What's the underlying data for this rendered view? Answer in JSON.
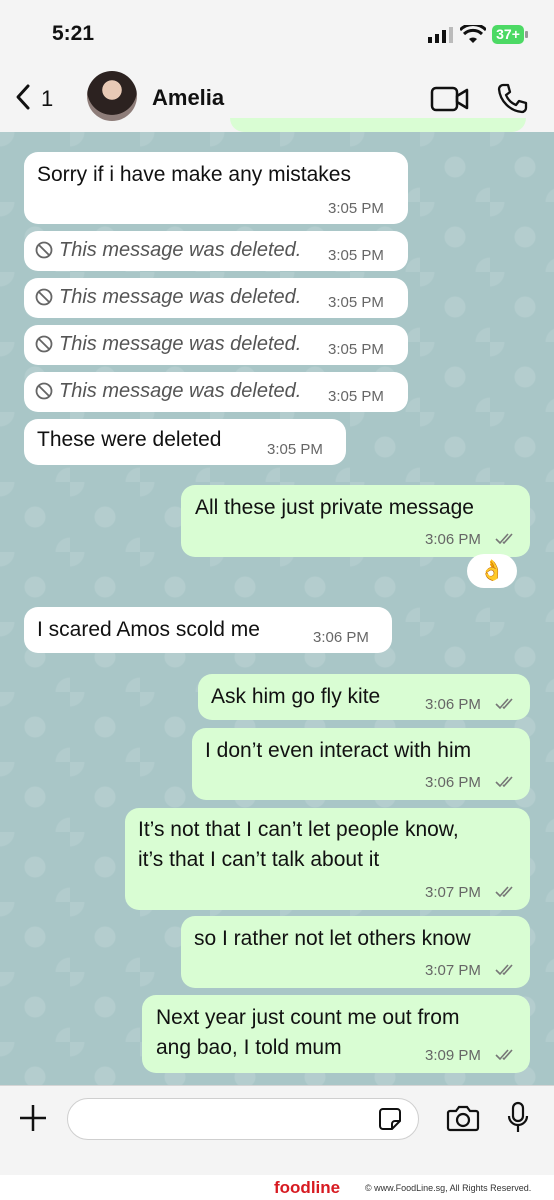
{
  "status_bar": {
    "time": "5:21",
    "battery": "37+"
  },
  "header": {
    "back_count": "1",
    "contact_name": "Amelia"
  },
  "messages": [
    {
      "side": "in",
      "text": "Sorry if i have make any mistakes",
      "time": "3:05 PM"
    },
    {
      "side": "in",
      "deleted": true,
      "text": "This message was deleted.",
      "time": "3:05 PM"
    },
    {
      "side": "in",
      "deleted": true,
      "text": "This message was deleted.",
      "time": "3:05 PM"
    },
    {
      "side": "in",
      "deleted": true,
      "text": "This message was deleted.",
      "time": "3:05 PM"
    },
    {
      "side": "in",
      "deleted": true,
      "text": "This message was deleted.",
      "time": "3:05 PM"
    },
    {
      "side": "in",
      "text": "These were deleted",
      "time": "3:05 PM"
    },
    {
      "side": "out",
      "text": "All these just private message",
      "time": "3:06 PM",
      "reaction": "👌"
    },
    {
      "side": "in",
      "text": "I scared Amos scold me",
      "time": "3:06 PM"
    },
    {
      "side": "out",
      "text": "Ask him go fly kite",
      "time": "3:06 PM"
    },
    {
      "side": "out",
      "text": "I don’t even interact with him",
      "time": "3:06 PM"
    },
    {
      "side": "out",
      "lines": [
        "It’s not that I can’t let people know,",
        "it’s that I can’t talk about it"
      ],
      "time": "3:07 PM"
    },
    {
      "side": "out",
      "text": "so I rather not let others know",
      "time": "3:07 PM"
    },
    {
      "side": "out",
      "lines": [
        "Next year just count me out from",
        "ang bao, I told mum"
      ],
      "time": "3:09 PM"
    }
  ],
  "input": {
    "placeholder": ""
  },
  "footer": {
    "brand": "foodline",
    "copyright": "© www.FoodLine.sg, All Rights Reserved."
  },
  "colors": {
    "incoming_bubble": "#ffffff",
    "outgoing_bubble": "#d9fdd3",
    "chat_background": "#a9c6c7",
    "brand_red": "#d71a21"
  }
}
